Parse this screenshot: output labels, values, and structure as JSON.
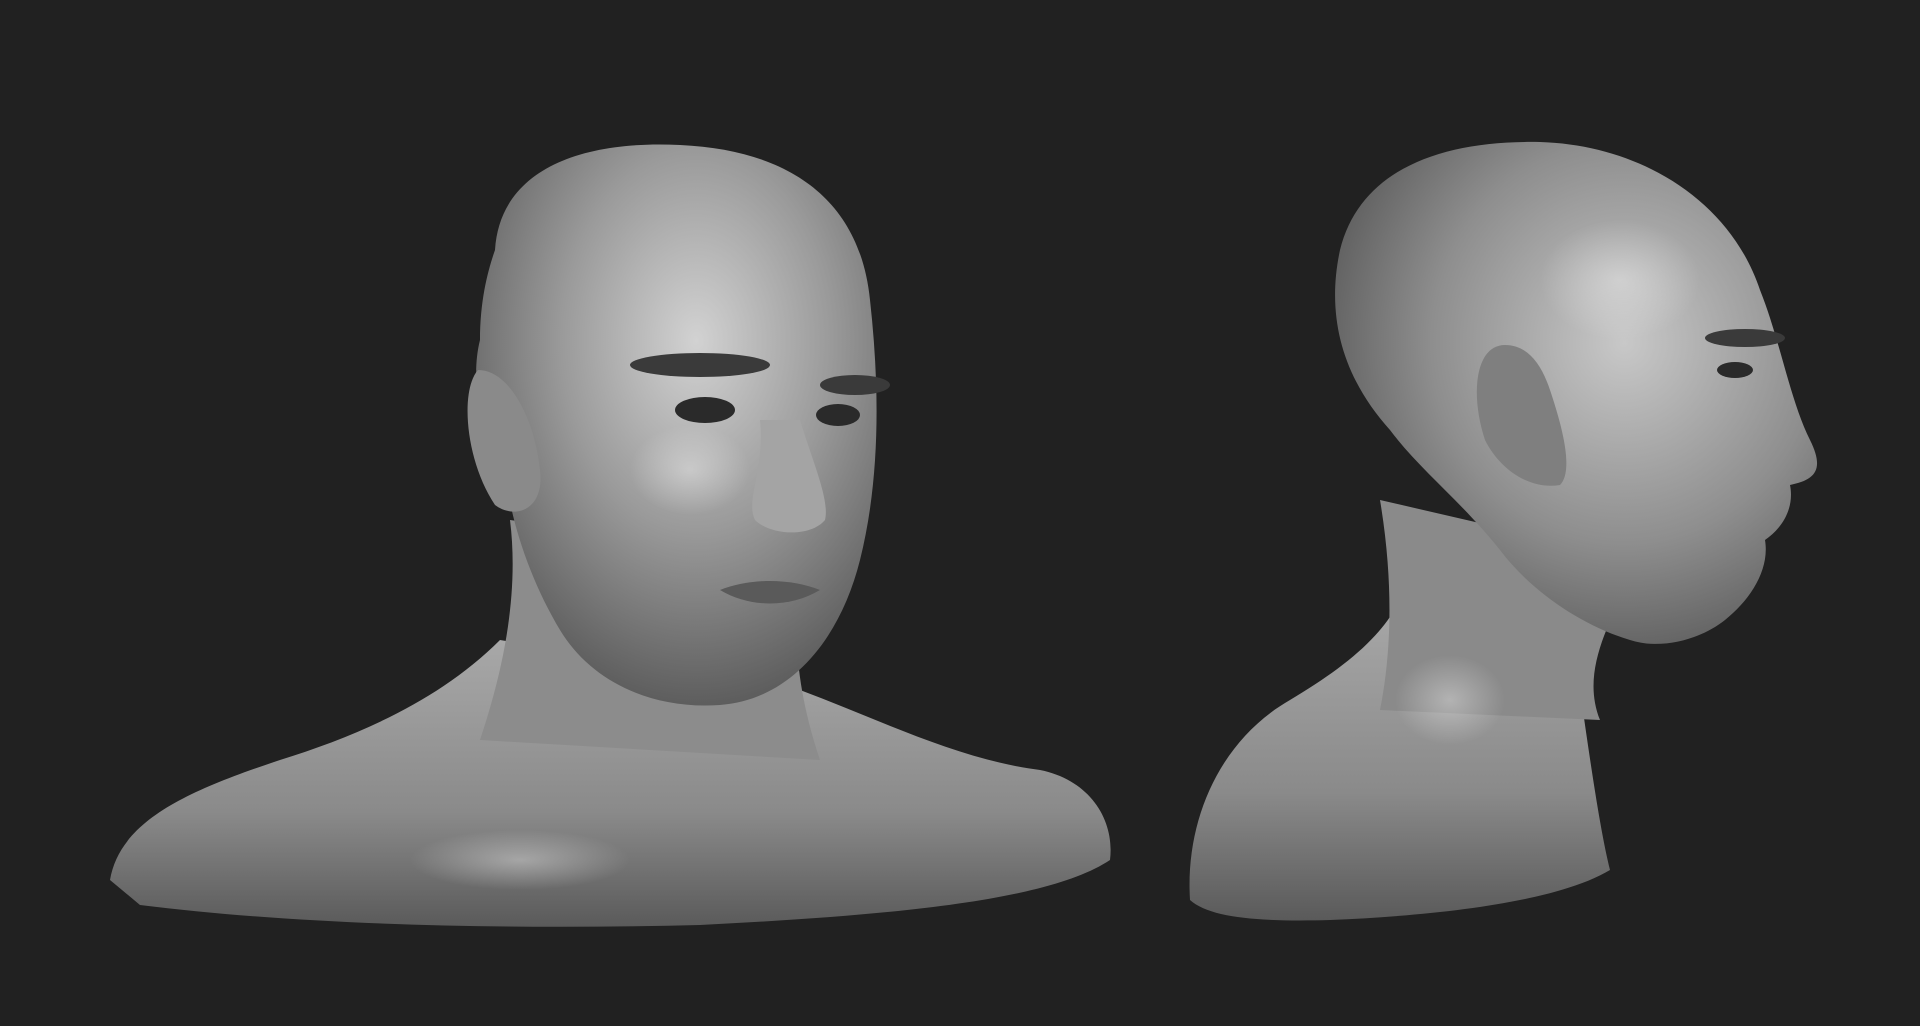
{
  "scene": {
    "background_color": "#212121",
    "clay_base_color": "#8f8f8f",
    "clay_highlight_color": "#d4d4d4",
    "clay_shadow_color": "#3a3a3a",
    "views": [
      {
        "id": "three-quarter",
        "subject": "bust"
      },
      {
        "id": "profile",
        "subject": "bust"
      }
    ]
  }
}
